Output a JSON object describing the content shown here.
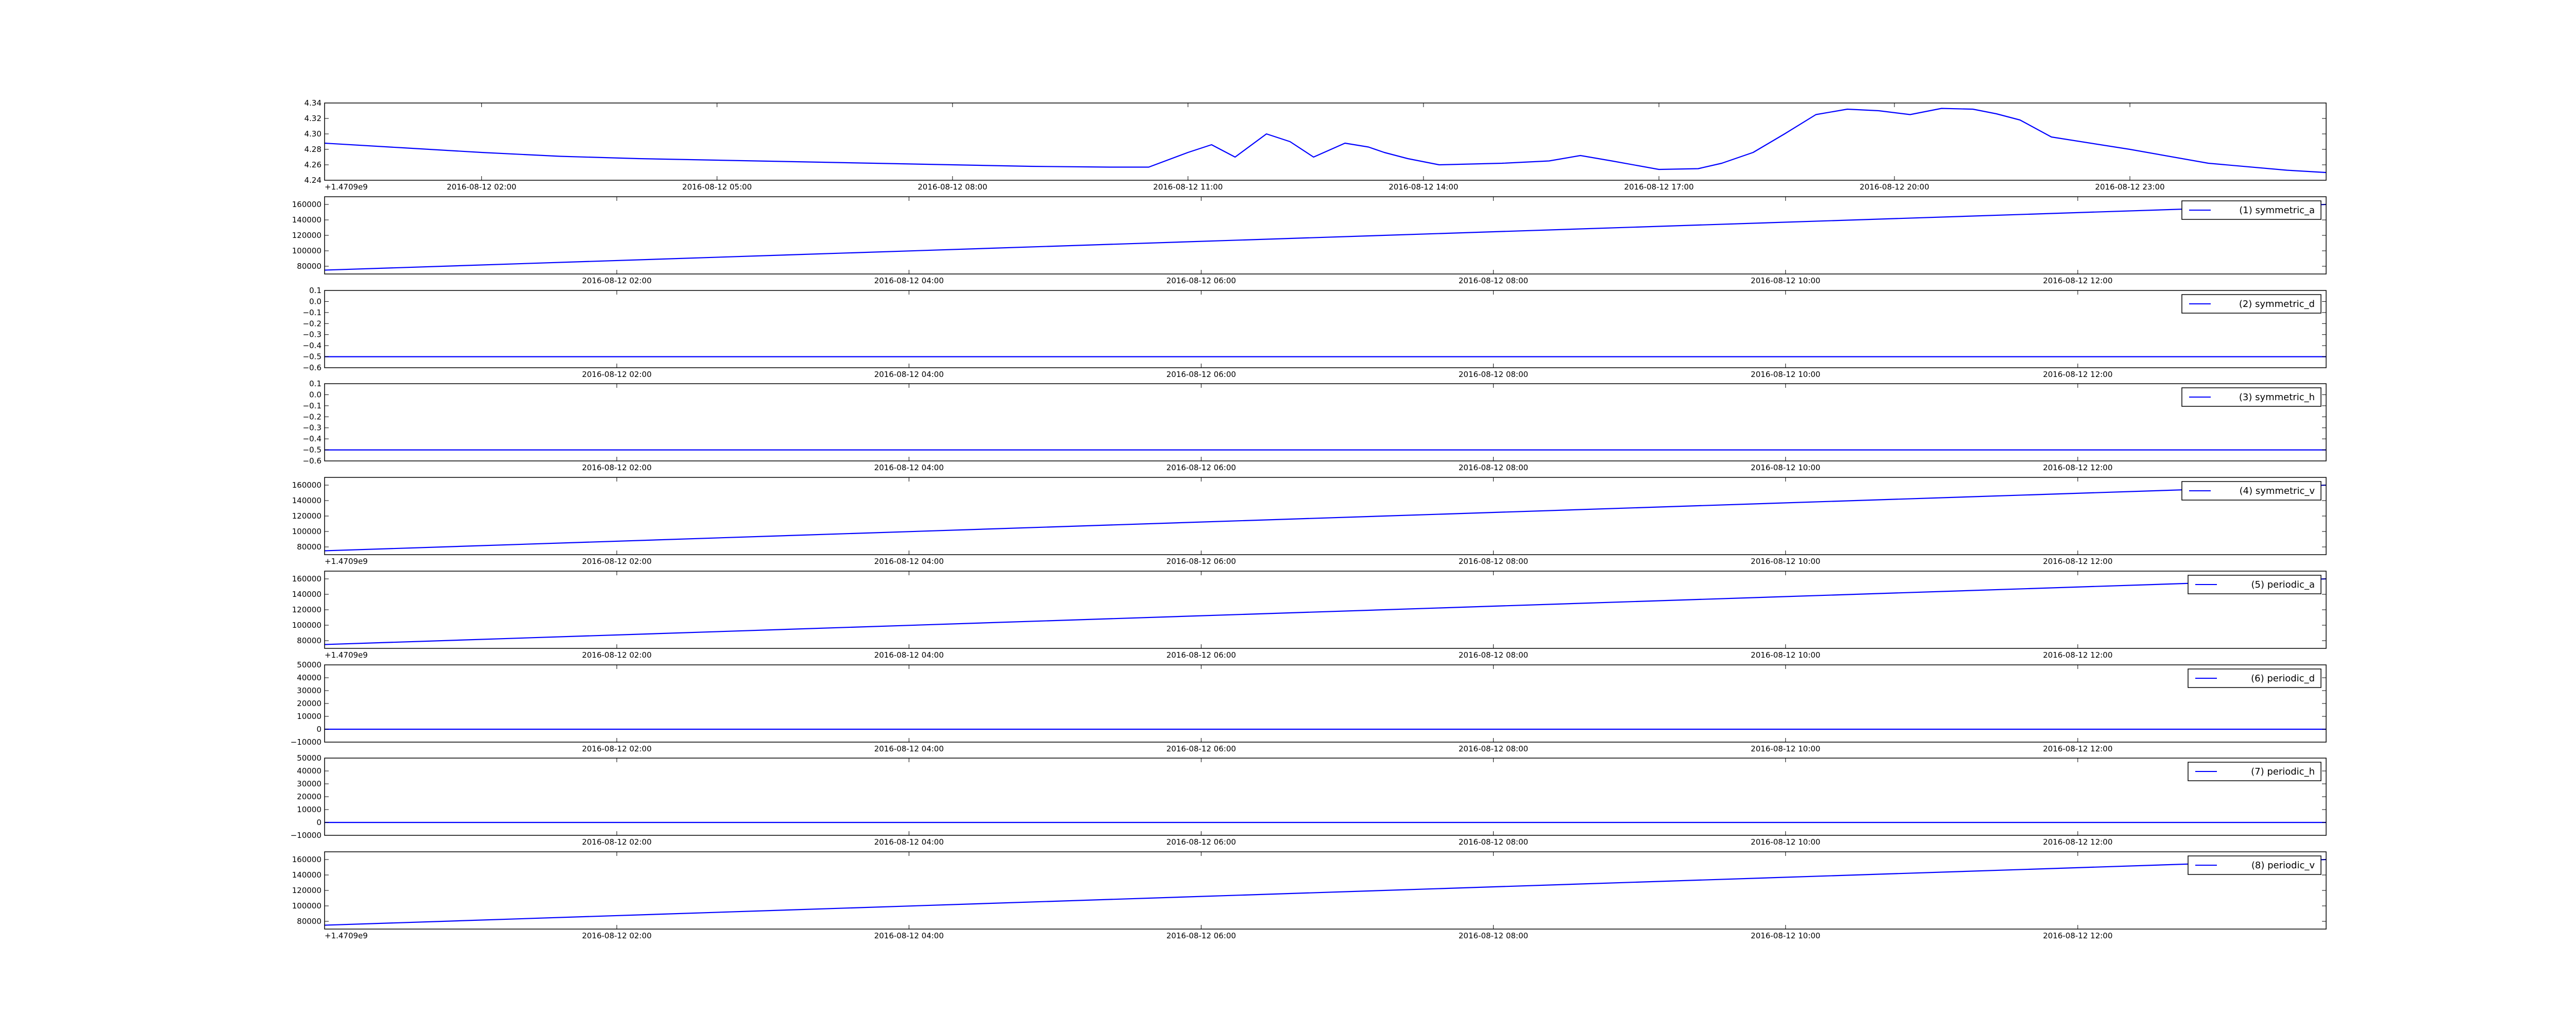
{
  "line_color": "#0000ff",
  "chart_data": [
    {
      "type": "line",
      "ylim": [
        4.24,
        4.34
      ],
      "yticks": [
        4.24,
        4.26,
        4.28,
        4.3,
        4.32,
        4.34
      ],
      "ytick_labels": [
        "4.24",
        "4.26",
        "4.28",
        "4.30",
        "4.32",
        "4.34"
      ],
      "offset_text": "+1.4709e9",
      "x_hours_range": [
        0,
        25.5
      ],
      "xticks_hours": [
        2,
        5,
        8,
        11,
        14,
        17,
        20,
        23
      ],
      "xtick_labels": [
        "2016-08-12 02:00",
        "2016-08-12 05:00",
        "2016-08-12 08:00",
        "2016-08-12 11:00",
        "2016-08-12 14:00",
        "2016-08-12 17:00",
        "2016-08-12 20:00",
        "2016-08-12 23:00"
      ],
      "series": [
        {
          "x_hours": [
            0,
            1,
            2,
            3,
            4,
            5,
            6,
            7,
            8,
            9,
            10,
            10.5,
            11,
            11.3,
            11.6,
            12.0,
            12.3,
            12.6,
            13.0,
            13.3,
            13.5,
            13.8,
            14.2,
            15,
            15.6,
            16.0,
            16.4,
            17.0,
            17.5,
            17.8,
            18.2,
            18.6,
            19.0,
            19.4,
            19.8,
            20.2,
            20.6,
            21.0,
            21.3,
            21.6,
            22.0,
            23.0,
            24.0,
            25.0,
            25.5
          ],
          "values": [
            4.288,
            4.282,
            4.276,
            4.271,
            4.268,
            4.266,
            4.264,
            4.262,
            4.26,
            4.258,
            4.257,
            4.257,
            4.276,
            4.286,
            4.27,
            4.3,
            4.29,
            4.27,
            4.288,
            4.283,
            4.276,
            4.268,
            4.26,
            4.262,
            4.265,
            4.272,
            4.265,
            4.254,
            4.255,
            4.262,
            4.276,
            4.3,
            4.325,
            4.332,
            4.33,
            4.325,
            4.333,
            4.332,
            4.326,
            4.318,
            4.296,
            4.28,
            4.262,
            4.253,
            4.25
          ]
        }
      ]
    },
    {
      "type": "line",
      "ylim": [
        70000,
        170000
      ],
      "yticks": [
        80000,
        100000,
        120000,
        140000,
        160000
      ],
      "ytick_labels": [
        "80000",
        "100000",
        "120000",
        "140000",
        "160000"
      ],
      "offset_text": "",
      "x_hours_range": [
        0,
        13.7
      ],
      "xticks_hours": [
        2,
        4,
        6,
        8,
        10,
        12
      ],
      "xtick_labels": [
        "2016-08-12 02:00",
        "2016-08-12 04:00",
        "2016-08-12 06:00",
        "2016-08-12 08:00",
        "2016-08-12 10:00",
        "2016-08-12 12:00"
      ],
      "series": [
        {
          "name": "(1) symmetric_a",
          "x_hours": [
            0,
            13.7
          ],
          "values": [
            75000,
            160000
          ]
        }
      ]
    },
    {
      "type": "line",
      "ylim": [
        -0.6,
        0.1
      ],
      "yticks": [
        -0.6,
        -0.5,
        -0.4,
        -0.3,
        -0.2,
        -0.1,
        0.0,
        0.1
      ],
      "ytick_labels": [
        "−0.6",
        "−0.5",
        "−0.4",
        "−0.3",
        "−0.2",
        "−0.1",
        "0.0",
        "0.1"
      ],
      "offset_text": "",
      "x_hours_range": [
        0,
        13.7
      ],
      "xticks_hours": [
        2,
        4,
        6,
        8,
        10,
        12
      ],
      "xtick_labels": [
        "2016-08-12 02:00",
        "2016-08-12 04:00",
        "2016-08-12 06:00",
        "2016-08-12 08:00",
        "2016-08-12 10:00",
        "2016-08-12 12:00"
      ],
      "series": [
        {
          "name": "(2) symmetric_d",
          "x_hours": [
            0,
            13.7
          ],
          "values": [
            -0.5,
            -0.5
          ]
        }
      ]
    },
    {
      "type": "line",
      "ylim": [
        -0.6,
        0.1
      ],
      "yticks": [
        -0.6,
        -0.5,
        -0.4,
        -0.3,
        -0.2,
        -0.1,
        0.0,
        0.1
      ],
      "ytick_labels": [
        "−0.6",
        "−0.5",
        "−0.4",
        "−0.3",
        "−0.2",
        "−0.1",
        "0.0",
        "0.1"
      ],
      "offset_text": "",
      "x_hours_range": [
        0,
        13.7
      ],
      "xticks_hours": [
        2,
        4,
        6,
        8,
        10,
        12
      ],
      "xtick_labels": [
        "2016-08-12 02:00",
        "2016-08-12 04:00",
        "2016-08-12 06:00",
        "2016-08-12 08:00",
        "2016-08-12 10:00",
        "2016-08-12 12:00"
      ],
      "series": [
        {
          "name": "(3) symmetric_h",
          "x_hours": [
            0,
            13.7
          ],
          "values": [
            -0.5,
            -0.5
          ]
        }
      ]
    },
    {
      "type": "line",
      "ylim": [
        70000,
        170000
      ],
      "yticks": [
        80000,
        100000,
        120000,
        140000,
        160000
      ],
      "ytick_labels": [
        "80000",
        "100000",
        "120000",
        "140000",
        "160000"
      ],
      "offset_text": "+1.4709e9",
      "x_hours_range": [
        0,
        13.7
      ],
      "xticks_hours": [
        2,
        4,
        6,
        8,
        10,
        12
      ],
      "xtick_labels": [
        "2016-08-12 02:00",
        "2016-08-12 04:00",
        "2016-08-12 06:00",
        "2016-08-12 08:00",
        "2016-08-12 10:00",
        "2016-08-12 12:00"
      ],
      "series": [
        {
          "name": "(4) symmetric_v",
          "x_hours": [
            0,
            13.7
          ],
          "values": [
            75000,
            160000
          ]
        }
      ]
    },
    {
      "type": "line",
      "ylim": [
        70000,
        170000
      ],
      "yticks": [
        80000,
        100000,
        120000,
        140000,
        160000
      ],
      "ytick_labels": [
        "80000",
        "100000",
        "120000",
        "140000",
        "160000"
      ],
      "offset_text": "+1.4709e9",
      "x_hours_range": [
        0,
        13.7
      ],
      "xticks_hours": [
        2,
        4,
        6,
        8,
        10,
        12
      ],
      "xtick_labels": [
        "2016-08-12 02:00",
        "2016-08-12 04:00",
        "2016-08-12 06:00",
        "2016-08-12 08:00",
        "2016-08-12 10:00",
        "2016-08-12 12:00"
      ],
      "series": [
        {
          "name": "(5) periodic_a",
          "x_hours": [
            0,
            13.7
          ],
          "values": [
            75000,
            160000
          ]
        }
      ]
    },
    {
      "type": "line",
      "ylim": [
        -10000,
        50000
      ],
      "yticks": [
        -10000,
        0,
        10000,
        20000,
        30000,
        40000,
        50000
      ],
      "ytick_labels": [
        "−10000",
        "0",
        "10000",
        "20000",
        "30000",
        "40000",
        "50000"
      ],
      "offset_text": "",
      "x_hours_range": [
        0,
        13.7
      ],
      "xticks_hours": [
        2,
        4,
        6,
        8,
        10,
        12
      ],
      "xtick_labels": [
        "2016-08-12 02:00",
        "2016-08-12 04:00",
        "2016-08-12 06:00",
        "2016-08-12 08:00",
        "2016-08-12 10:00",
        "2016-08-12 12:00"
      ],
      "series": [
        {
          "name": "(6) periodic_d",
          "x_hours": [
            0,
            13.7
          ],
          "values": [
            0,
            0
          ]
        }
      ]
    },
    {
      "type": "line",
      "ylim": [
        -10000,
        50000
      ],
      "yticks": [
        -10000,
        0,
        10000,
        20000,
        30000,
        40000,
        50000
      ],
      "ytick_labels": [
        "−10000",
        "0",
        "10000",
        "20000",
        "30000",
        "40000",
        "50000"
      ],
      "offset_text": "",
      "x_hours_range": [
        0,
        13.7
      ],
      "xticks_hours": [
        2,
        4,
        6,
        8,
        10,
        12
      ],
      "xtick_labels": [
        "2016-08-12 02:00",
        "2016-08-12 04:00",
        "2016-08-12 06:00",
        "2016-08-12 08:00",
        "2016-08-12 10:00",
        "2016-08-12 12:00"
      ],
      "series": [
        {
          "name": "(7) periodic_h",
          "x_hours": [
            0,
            13.7
          ],
          "values": [
            0,
            0
          ]
        }
      ]
    },
    {
      "type": "line",
      "ylim": [
        70000,
        170000
      ],
      "yticks": [
        80000,
        100000,
        120000,
        140000,
        160000
      ],
      "ytick_labels": [
        "80000",
        "100000",
        "120000",
        "140000",
        "160000"
      ],
      "offset_text": "+1.4709e9",
      "x_hours_range": [
        0,
        13.7
      ],
      "xticks_hours": [
        2,
        4,
        6,
        8,
        10,
        12
      ],
      "xtick_labels": [
        "2016-08-12 02:00",
        "2016-08-12 04:00",
        "2016-08-12 06:00",
        "2016-08-12 08:00",
        "2016-08-12 10:00",
        "2016-08-12 12:00"
      ],
      "series": [
        {
          "name": "(8) periodic_v",
          "x_hours": [
            0,
            13.7
          ],
          "values": [
            75000,
            160000
          ]
        }
      ]
    }
  ]
}
